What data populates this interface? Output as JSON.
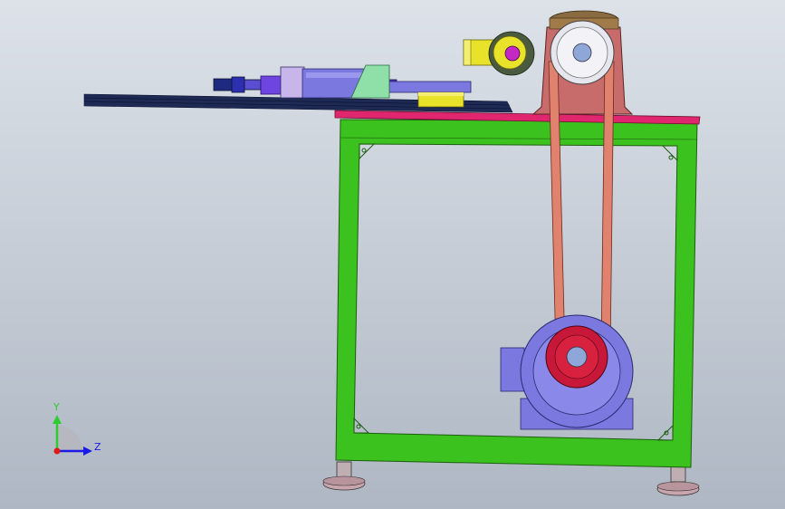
{
  "viewport": {
    "background_top": "#dde2e9",
    "background_bottom": "#aeb7c3"
  },
  "triad": {
    "y_label": "Y",
    "z_label": "Z",
    "y_color": "#2ecc2e",
    "z_color": "#1a1ae6",
    "origin_color": "#e01a1a"
  },
  "colors": {
    "frame": "#3cc21e",
    "table_top": "#e0266e",
    "pulley_housing": "#c86b6b",
    "belt": "#e0826e",
    "motor": "#7b78e0",
    "motor_pulley": "#c8183a",
    "cylinder": "#7b78e0",
    "bracket": "#e8e22a",
    "guide_rail": "#1e2a54",
    "wedge": "#8ee0a8"
  }
}
